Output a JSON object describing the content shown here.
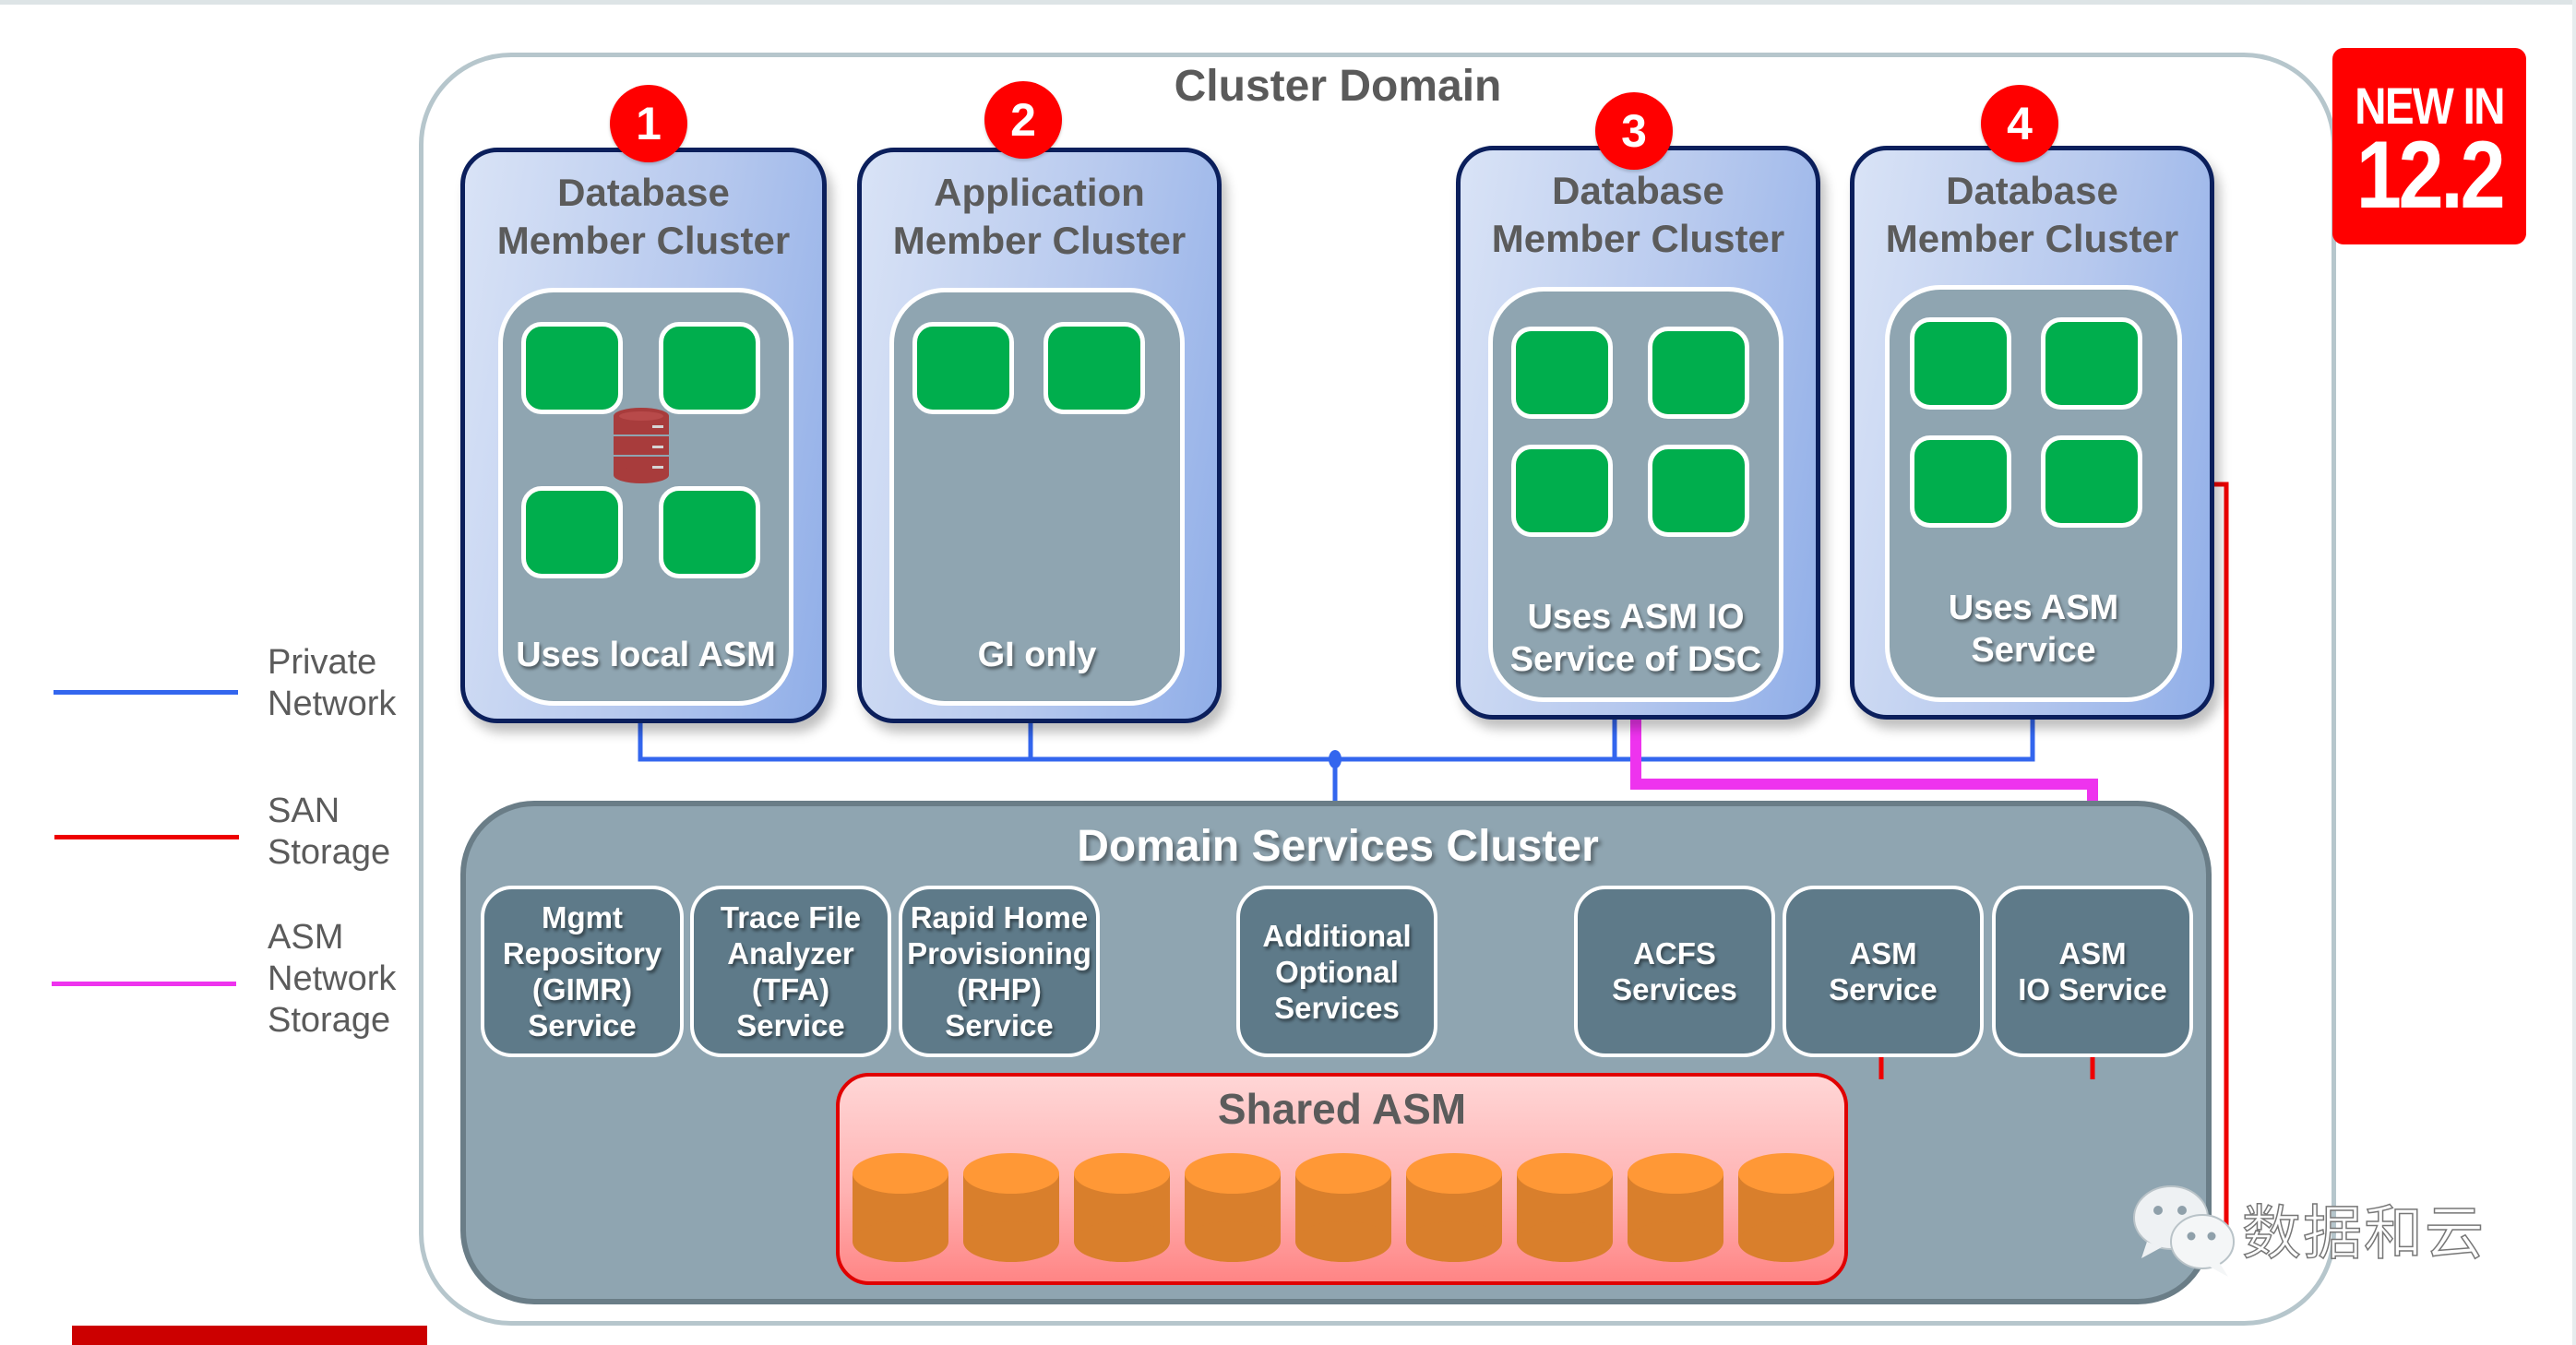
{
  "diagram_title": "Cluster Domain",
  "badge": {
    "line1": "NEW IN",
    "line2": "12.2",
    "color": "#ff0000"
  },
  "legend": [
    {
      "name": "private-network",
      "label_line1": "Private",
      "label_line2": "Network",
      "label_line3": "",
      "color": "#3366ee"
    },
    {
      "name": "san-storage",
      "label_line1": "SAN",
      "label_line2": "Storage",
      "label_line3": "",
      "color": "#ee0000"
    },
    {
      "name": "asm-network-storage",
      "label_line1": "ASM",
      "label_line2": "Network",
      "label_line3": "Storage",
      "color": "#ee33ee"
    }
  ],
  "member_clusters": [
    {
      "number": "1",
      "title_line1": "Database",
      "title_line2": "Member Cluster",
      "label_line1": "Uses local ASM",
      "label_line2": "",
      "nodes": 4,
      "has_local_db": true
    },
    {
      "number": "2",
      "title_line1": "Application",
      "title_line2": "Member Cluster",
      "label_line1": "GI only",
      "label_line2": "",
      "nodes": 2,
      "has_local_db": false
    },
    {
      "number": "3",
      "title_line1": "Database",
      "title_line2": "Member Cluster",
      "label_line1": "Uses ASM IO",
      "label_line2": "Service of  DSC",
      "nodes": 4,
      "has_local_db": false
    },
    {
      "number": "4",
      "title_line1": "Database",
      "title_line2": "Member Cluster",
      "label_line1": "Uses ASM",
      "label_line2": "Service",
      "nodes": 4,
      "has_local_db": false
    }
  ],
  "domain_services_cluster": {
    "title": "Domain Services Cluster",
    "services": [
      {
        "lines": [
          "Mgmt",
          "Repository",
          "(GIMR)",
          "Service"
        ]
      },
      {
        "lines": [
          "Trace File",
          "Analyzer",
          "(TFA)",
          "Service"
        ]
      },
      {
        "lines": [
          "Rapid Home",
          "Provisioning",
          "(RHP)",
          "Service"
        ]
      },
      {
        "lines": [
          "Additional",
          "Optional",
          "Services"
        ]
      },
      {
        "lines": [
          "ACFS",
          "Services"
        ]
      },
      {
        "lines": [
          "ASM",
          "Service"
        ]
      },
      {
        "lines": [
          "ASM",
          "IO Service"
        ]
      }
    ],
    "shared_asm": {
      "title": "Shared ASM",
      "disk_count": 9
    }
  },
  "colors": {
    "private_network": "#3366ee",
    "san": "#ee0000",
    "asm_network": "#ee33ee",
    "node_green": "#00ae4d",
    "disk_orange": "#e08030"
  },
  "watermark": {
    "text": "数据和云",
    "icon": "wechat-icon"
  }
}
